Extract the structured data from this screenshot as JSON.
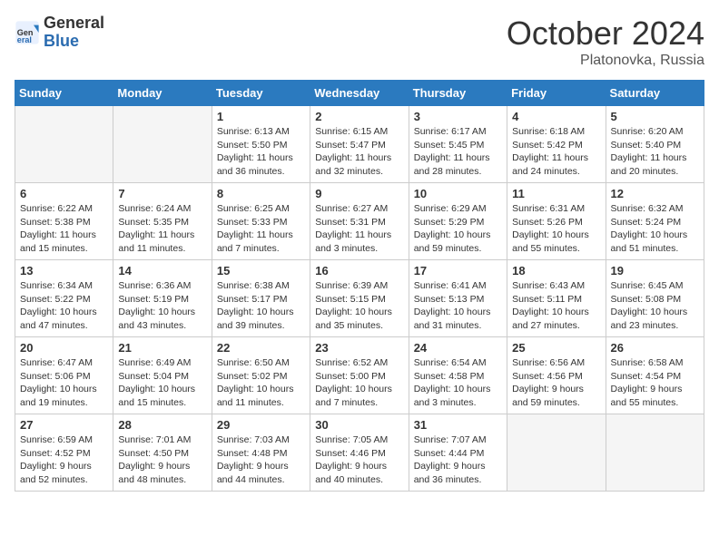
{
  "header": {
    "logo_general": "General",
    "logo_blue": "Blue",
    "month": "October 2024",
    "location": "Platonovka, Russia"
  },
  "days_of_week": [
    "Sunday",
    "Monday",
    "Tuesday",
    "Wednesday",
    "Thursday",
    "Friday",
    "Saturday"
  ],
  "weeks": [
    [
      {
        "day": "",
        "text": "",
        "empty": true
      },
      {
        "day": "",
        "text": "",
        "empty": true
      },
      {
        "day": "1",
        "text": "Sunrise: 6:13 AM\nSunset: 5:50 PM\nDaylight: 11 hours\nand 36 minutes."
      },
      {
        "day": "2",
        "text": "Sunrise: 6:15 AM\nSunset: 5:47 PM\nDaylight: 11 hours\nand 32 minutes."
      },
      {
        "day": "3",
        "text": "Sunrise: 6:17 AM\nSunset: 5:45 PM\nDaylight: 11 hours\nand 28 minutes."
      },
      {
        "day": "4",
        "text": "Sunrise: 6:18 AM\nSunset: 5:42 PM\nDaylight: 11 hours\nand 24 minutes."
      },
      {
        "day": "5",
        "text": "Sunrise: 6:20 AM\nSunset: 5:40 PM\nDaylight: 11 hours\nand 20 minutes."
      }
    ],
    [
      {
        "day": "6",
        "text": "Sunrise: 6:22 AM\nSunset: 5:38 PM\nDaylight: 11 hours\nand 15 minutes."
      },
      {
        "day": "7",
        "text": "Sunrise: 6:24 AM\nSunset: 5:35 PM\nDaylight: 11 hours\nand 11 minutes."
      },
      {
        "day": "8",
        "text": "Sunrise: 6:25 AM\nSunset: 5:33 PM\nDaylight: 11 hours\nand 7 minutes."
      },
      {
        "day": "9",
        "text": "Sunrise: 6:27 AM\nSunset: 5:31 PM\nDaylight: 11 hours\nand 3 minutes."
      },
      {
        "day": "10",
        "text": "Sunrise: 6:29 AM\nSunset: 5:29 PM\nDaylight: 10 hours\nand 59 minutes."
      },
      {
        "day": "11",
        "text": "Sunrise: 6:31 AM\nSunset: 5:26 PM\nDaylight: 10 hours\nand 55 minutes."
      },
      {
        "day": "12",
        "text": "Sunrise: 6:32 AM\nSunset: 5:24 PM\nDaylight: 10 hours\nand 51 minutes."
      }
    ],
    [
      {
        "day": "13",
        "text": "Sunrise: 6:34 AM\nSunset: 5:22 PM\nDaylight: 10 hours\nand 47 minutes."
      },
      {
        "day": "14",
        "text": "Sunrise: 6:36 AM\nSunset: 5:19 PM\nDaylight: 10 hours\nand 43 minutes."
      },
      {
        "day": "15",
        "text": "Sunrise: 6:38 AM\nSunset: 5:17 PM\nDaylight: 10 hours\nand 39 minutes."
      },
      {
        "day": "16",
        "text": "Sunrise: 6:39 AM\nSunset: 5:15 PM\nDaylight: 10 hours\nand 35 minutes."
      },
      {
        "day": "17",
        "text": "Sunrise: 6:41 AM\nSunset: 5:13 PM\nDaylight: 10 hours\nand 31 minutes."
      },
      {
        "day": "18",
        "text": "Sunrise: 6:43 AM\nSunset: 5:11 PM\nDaylight: 10 hours\nand 27 minutes."
      },
      {
        "day": "19",
        "text": "Sunrise: 6:45 AM\nSunset: 5:08 PM\nDaylight: 10 hours\nand 23 minutes."
      }
    ],
    [
      {
        "day": "20",
        "text": "Sunrise: 6:47 AM\nSunset: 5:06 PM\nDaylight: 10 hours\nand 19 minutes."
      },
      {
        "day": "21",
        "text": "Sunrise: 6:49 AM\nSunset: 5:04 PM\nDaylight: 10 hours\nand 15 minutes."
      },
      {
        "day": "22",
        "text": "Sunrise: 6:50 AM\nSunset: 5:02 PM\nDaylight: 10 hours\nand 11 minutes."
      },
      {
        "day": "23",
        "text": "Sunrise: 6:52 AM\nSunset: 5:00 PM\nDaylight: 10 hours\nand 7 minutes."
      },
      {
        "day": "24",
        "text": "Sunrise: 6:54 AM\nSunset: 4:58 PM\nDaylight: 10 hours\nand 3 minutes."
      },
      {
        "day": "25",
        "text": "Sunrise: 6:56 AM\nSunset: 4:56 PM\nDaylight: 9 hours\nand 59 minutes."
      },
      {
        "day": "26",
        "text": "Sunrise: 6:58 AM\nSunset: 4:54 PM\nDaylight: 9 hours\nand 55 minutes."
      }
    ],
    [
      {
        "day": "27",
        "text": "Sunrise: 6:59 AM\nSunset: 4:52 PM\nDaylight: 9 hours\nand 52 minutes."
      },
      {
        "day": "28",
        "text": "Sunrise: 7:01 AM\nSunset: 4:50 PM\nDaylight: 9 hours\nand 48 minutes."
      },
      {
        "day": "29",
        "text": "Sunrise: 7:03 AM\nSunset: 4:48 PM\nDaylight: 9 hours\nand 44 minutes."
      },
      {
        "day": "30",
        "text": "Sunrise: 7:05 AM\nSunset: 4:46 PM\nDaylight: 9 hours\nand 40 minutes."
      },
      {
        "day": "31",
        "text": "Sunrise: 7:07 AM\nSunset: 4:44 PM\nDaylight: 9 hours\nand 36 minutes."
      },
      {
        "day": "",
        "text": "",
        "empty": true
      },
      {
        "day": "",
        "text": "",
        "empty": true
      }
    ]
  ]
}
